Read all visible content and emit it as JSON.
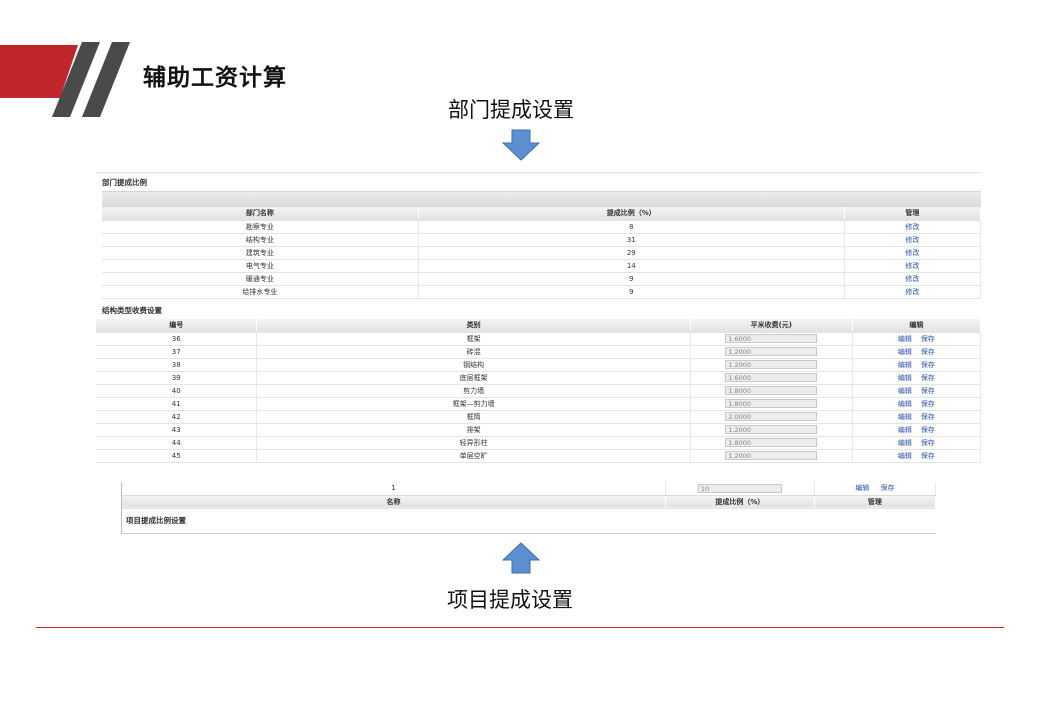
{
  "slide": {
    "title": "辅助工资计算",
    "caption_top": "部门提成设置",
    "caption_bottom": "项目提成设置",
    "accent_color": "#c0262b",
    "arrow_color": "#5b8fd0"
  },
  "dept": {
    "section_title": "部门提成比例",
    "headers": [
      "部门名称",
      "提成比例（%）",
      "管理"
    ],
    "action_label": "修改",
    "rows": [
      {
        "name": "勘察专业",
        "ratio": "8"
      },
      {
        "name": "结构专业",
        "ratio": "31"
      },
      {
        "name": "建筑专业",
        "ratio": "29"
      },
      {
        "name": "电气专业",
        "ratio": "14"
      },
      {
        "name": "暖通专业",
        "ratio": "9"
      },
      {
        "name": "给排水专业",
        "ratio": "9"
      }
    ]
  },
  "struct": {
    "section_title": "结构类型收费设置",
    "headers": [
      "编号",
      "类别",
      "平米收费(元)",
      "编辑"
    ],
    "edit_label": "编辑",
    "save_label": "保存",
    "rows": [
      {
        "id": "36",
        "type": "框架",
        "fee": "1.6000"
      },
      {
        "id": "37",
        "type": "砖混",
        "fee": "1.2000"
      },
      {
        "id": "38",
        "type": "钢结构",
        "fee": "1.2000"
      },
      {
        "id": "39",
        "type": "底层框架",
        "fee": "1.6000"
      },
      {
        "id": "40",
        "type": "剪力墙",
        "fee": "1.8000"
      },
      {
        "id": "41",
        "type": "框架—剪力墙",
        "fee": "1.8000"
      },
      {
        "id": "42",
        "type": "框筒",
        "fee": "2.0000"
      },
      {
        "id": "43",
        "type": "排架",
        "fee": "1.2000"
      },
      {
        "id": "44",
        "type": "轻异形柱",
        "fee": "1.8000"
      },
      {
        "id": "45",
        "type": "单层空旷",
        "fee": "1.2000"
      }
    ]
  },
  "project": {
    "row_label": "1",
    "row_value": "10",
    "edit_label": "编辑",
    "save_label": "保存",
    "headers": [
      "名称",
      "提成比例（%）",
      "管理"
    ],
    "title": "项目提成比例设置"
  }
}
